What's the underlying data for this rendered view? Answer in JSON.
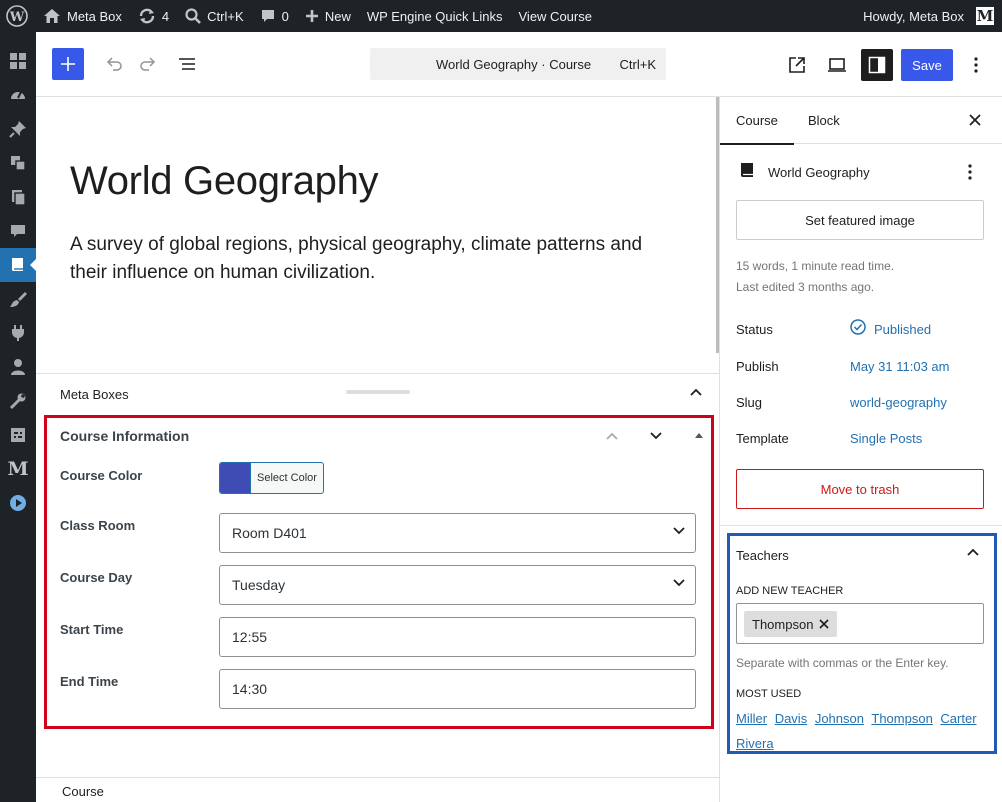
{
  "admin_bar": {
    "site_name": "Meta Box",
    "updates_count": "4",
    "search_shortcut": "Ctrl+K",
    "comments_count": "0",
    "new_label": "New",
    "wp_engine_label": "WP Engine Quick Links",
    "view_label": "View Course",
    "howdy": "Howdy, Meta Box",
    "avatar_letter": "M"
  },
  "admin_menu": {
    "items": [
      "dashboard-grid-icon",
      "gauge-icon",
      "pin-icon",
      "media-icon",
      "pages-icon",
      "comments-icon",
      "courses-book-icon",
      "appearance-brush-icon",
      "plugins-icon",
      "users-icon",
      "tools-wrench-icon",
      "settings-icon",
      "metabox-m-icon",
      "play-circle-icon"
    ],
    "active_index": 6,
    "metabox_letter": "M"
  },
  "editor_header": {
    "command_title": "World Geography · Course",
    "command_shortcut": "Ctrl+K",
    "save_label": "Save"
  },
  "post": {
    "title": "World Geography",
    "excerpt": "A survey of global regions, physical geography, climate patterns and their influence on human civilization."
  },
  "meta_boxes": {
    "header_label": "Meta Boxes",
    "course_info": {
      "title": "Course Information",
      "color_label": "Course Color",
      "color_value": "#3e4cb4",
      "color_button": "Select Color",
      "classroom_label": "Class Room",
      "classroom_value": "Room D401",
      "day_label": "Course Day",
      "day_value": "Tuesday",
      "start_label": "Start Time",
      "start_value": "12:55",
      "end_label": "End Time",
      "end_value": "14:30"
    }
  },
  "footer": {
    "breadcrumb": "Course"
  },
  "sidebar": {
    "tab_course": "Course",
    "tab_block": "Block",
    "post_title": "World Geography",
    "featured_image_label": "Set featured image",
    "read_time": "15 words, 1 minute read time.",
    "last_edited": "Last edited 3 months ago.",
    "status_label": "Status",
    "status_value": "Published",
    "publish_label": "Publish",
    "publish_value": "May 31 11:03 am",
    "slug_label": "Slug",
    "slug_value": "world-geography",
    "template_label": "Template",
    "template_value": "Single Posts",
    "trash_label": "Move to trash",
    "teachers": {
      "title": "Teachers",
      "add_label": "ADD NEW TEACHER",
      "token": "Thompson",
      "help": "Separate with commas or the Enter key.",
      "most_used_label": "MOST USED",
      "most_used": [
        "Miller",
        "Davis",
        "Johnson",
        "Thompson",
        "Carter",
        "Rivera"
      ]
    }
  },
  "colors": {
    "accent": "#3858e9",
    "admin_dark": "#1d2327",
    "highlight_red": "#d0021b",
    "highlight_blue": "#1f5bb5"
  }
}
